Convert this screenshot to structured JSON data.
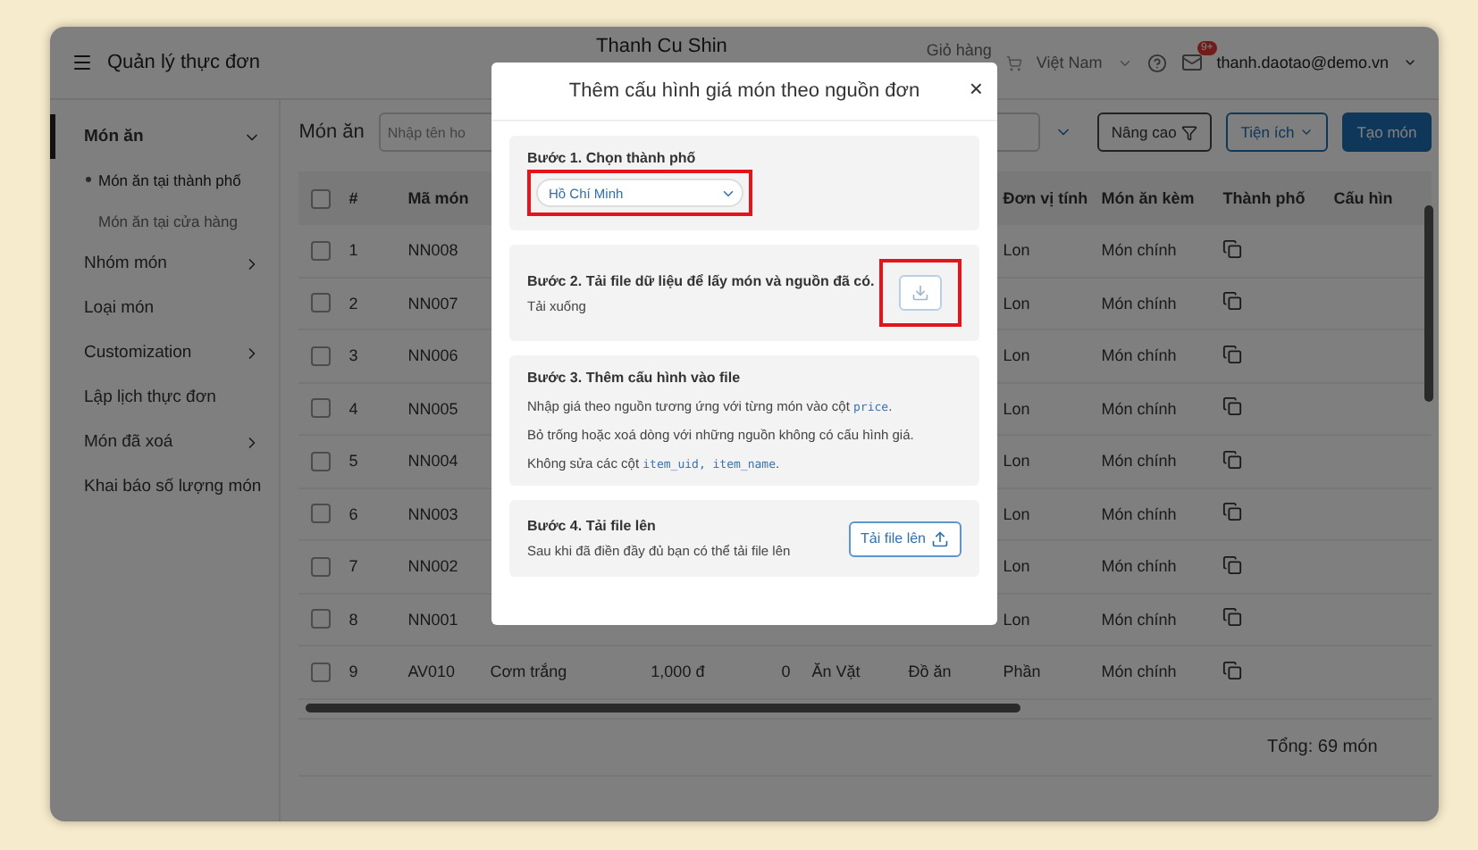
{
  "header": {
    "title": "Quản lý thực đơn",
    "store": "Thanh Cu Shin",
    "cart": "Giỏ hàng",
    "country": "Việt Nam",
    "mail_badge": "9+",
    "user": "thanh.daotao@demo.vn"
  },
  "sidebar": {
    "items": [
      {
        "label": "Món ăn",
        "selected": true,
        "expanded": true,
        "children": [
          {
            "label": "Món ăn tại thành phố",
            "selected": true
          },
          {
            "label": "Món ăn tại cửa hàng",
            "selected": false
          }
        ]
      },
      {
        "label": "Nhóm món",
        "selected": false,
        "expanded": false
      },
      {
        "label": "Loại món",
        "selected": false
      },
      {
        "label": "Customization",
        "selected": false,
        "expanded": false
      },
      {
        "label": "Lập lịch thực đơn",
        "selected": false
      },
      {
        "label": "Món đã xoá",
        "selected": false,
        "expanded": false
      },
      {
        "label": "Khai báo số lượng món",
        "selected": false
      }
    ]
  },
  "toolbar": {
    "title": "Món ăn",
    "search": {
      "placeholder": "Nhập tên ho"
    },
    "buttons": [
      {
        "label": "Nâng cao",
        "kind": "filter"
      },
      {
        "label": "Tiện ích",
        "kind": "menu"
      },
      {
        "label": "Tạo món",
        "kind": "primary"
      }
    ]
  },
  "table": {
    "all_checked": false,
    "columns": [
      {
        "label": "#"
      },
      {
        "label": "Mã món"
      },
      {
        "label": "Đơn vị tính"
      },
      {
        "label": "Món ăn kèm"
      },
      {
        "label": "Thành phố"
      },
      {
        "label": "Cấu hìn"
      }
    ],
    "rows": [
      {
        "num": "1",
        "code": "NN008",
        "unit": "Lon",
        "side": "Món chính",
        "checked": false
      },
      {
        "num": "2",
        "code": "NN007",
        "unit": "Lon",
        "side": "Món chính",
        "checked": false
      },
      {
        "num": "3",
        "code": "NN006",
        "unit": "Lon",
        "side": "Món chính",
        "checked": false
      },
      {
        "num": "4",
        "code": "NN005",
        "unit": "Lon",
        "side": "Món chính",
        "checked": false
      },
      {
        "num": "5",
        "code": "NN004",
        "unit": "Lon",
        "side": "Món chính",
        "checked": false
      },
      {
        "num": "6",
        "code": "NN003",
        "unit": "Lon",
        "side": "Món chính",
        "checked": false
      },
      {
        "num": "7",
        "code": "NN002",
        "unit": "Lon",
        "side": "Món chính",
        "checked": false
      },
      {
        "num": "8",
        "code": "NN001",
        "unit": "Lon",
        "side": "Món chính",
        "checked": false
      },
      {
        "num": "9",
        "code": "AV010",
        "name": "Cơm trắng",
        "price": "1,000 đ",
        "qty": "0",
        "group": "Ăn Vặt",
        "type": "Đồ ăn",
        "unit": "Phần",
        "side": "Món chính",
        "checked": false
      }
    ],
    "total": "Tổng: 69 món"
  },
  "modal": {
    "title": "Thêm cấu hình giá món theo nguồn đơn",
    "close": "×",
    "steps": [
      {
        "kind": "select",
        "title": "Bước 1. Chọn thành phố",
        "value": "Hồ Chí Minh",
        "highlighted": true
      },
      {
        "kind": "download",
        "title": "Bước 2. Tải file dữ liệu để lấy món và nguồn đã có.",
        "text": "Tải xuống",
        "highlighted": true
      },
      {
        "kind": "notes",
        "title": "Bước 3. Thêm cấu hình vào file",
        "lines": [
          {
            "before": "Nhập giá theo nguồn tương ứng với từng món vào cột ",
            "code": "price",
            "after": "."
          },
          {
            "before": "Bỏ trống hoặc xoá dòng với những nguồn không có cấu hình giá."
          },
          {
            "before": "Không sửa các cột ",
            "code": "item_uid, item_name",
            "after": "."
          }
        ]
      },
      {
        "kind": "upload",
        "title": "Bước 4. Tải file lên",
        "text": "Sau khi đã điền đầy đủ bạn có thể tải file lên",
        "button": "Tải file lên"
      }
    ]
  }
}
